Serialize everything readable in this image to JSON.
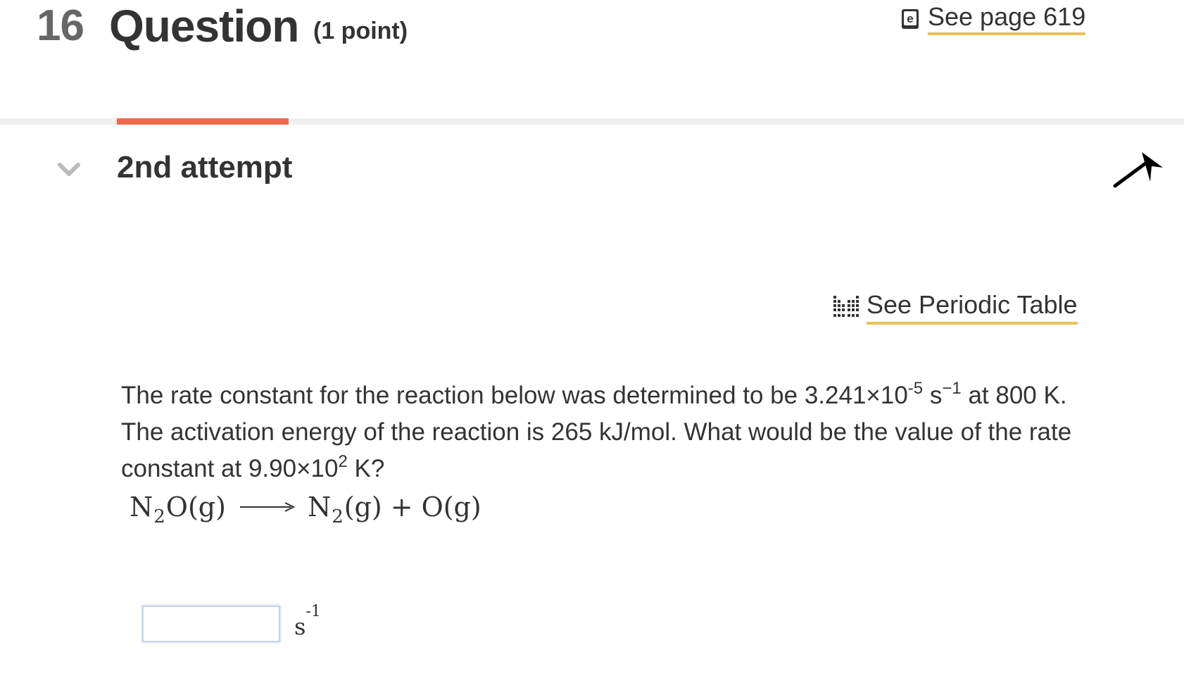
{
  "header": {
    "number": "16",
    "title": "Question",
    "points": "(1 point)",
    "see_page": "See page 619"
  },
  "attempt": {
    "label": "2nd attempt"
  },
  "periodic_table": {
    "label": "See Periodic Table"
  },
  "question": {
    "sentence1_a": "The rate constant for the reaction below was determined to be 3.241×10",
    "sentence1_exp": "-5",
    "sentence1_b": " s",
    "sentence1_unit_exp": "−1",
    "sentence1_c": " at 800 K.",
    "sentence2": "The activation energy of the reaction is 265  kJ/mol. What would be the value of the rate",
    "sentence3_a": "constant at 9.90×10",
    "sentence3_exp": "2",
    "sentence3_b": "  K?"
  },
  "equation": {
    "reactant_a": "N",
    "reactant_sub": "2",
    "reactant_b": "O(g)",
    "product1_a": "N",
    "product1_sub": "2",
    "product1_b": "(g)",
    "plus": "+",
    "product2": "O(g)"
  },
  "answer": {
    "value": "",
    "unit_base": "s",
    "unit_exp": "-1"
  },
  "colors": {
    "tab_active": "#ef6a4a",
    "link_underline": "#e8c15a",
    "text": "#333333",
    "number": "#666666"
  },
  "icons": {
    "see_page": "ebook-icon",
    "periodic": "periodic-table-icon",
    "attempt_toggle": "chevron-down-icon",
    "pointer": "cursor-arrow-icon"
  }
}
